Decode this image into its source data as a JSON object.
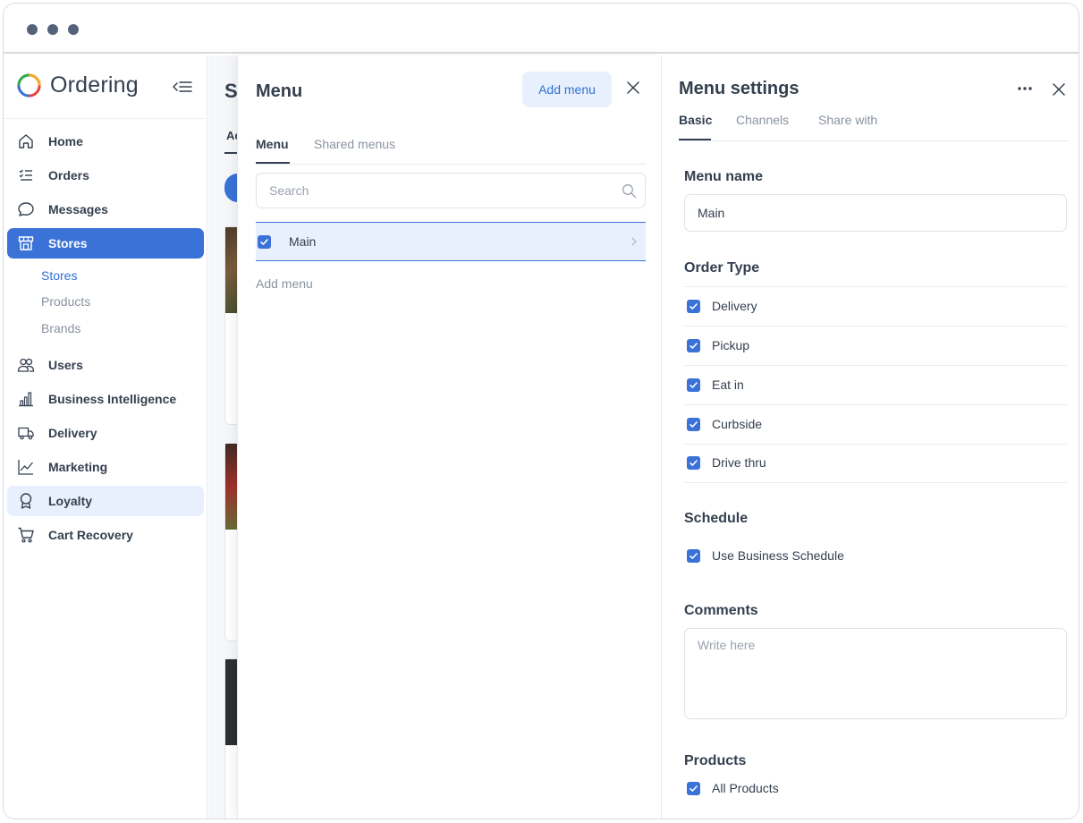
{
  "window": {
    "controls": [
      "close",
      "minimize",
      "zoom"
    ]
  },
  "sidebar": {
    "brand": "Ordering",
    "items": [
      {
        "label": "Home",
        "icon": "home-icon"
      },
      {
        "label": "Orders",
        "icon": "list-icon"
      },
      {
        "label": "Messages",
        "icon": "chat-icon"
      },
      {
        "label": "Stores",
        "icon": "store-icon",
        "active": true
      },
      {
        "label": "Users",
        "icon": "users-icon"
      },
      {
        "label": "Business Intelligence",
        "icon": "bar-chart-icon"
      },
      {
        "label": "Delivery",
        "icon": "truck-icon"
      },
      {
        "label": "Marketing",
        "icon": "trend-chart-icon"
      },
      {
        "label": "Loyalty",
        "icon": "award-icon"
      },
      {
        "label": "Cart Recovery",
        "icon": "cart-icon"
      }
    ],
    "sub_items": [
      {
        "label": "Stores",
        "active": true
      },
      {
        "label": "Products"
      },
      {
        "label": "Brands"
      }
    ]
  },
  "background": {
    "title_fragment": "S",
    "tab_fragment": "Ac"
  },
  "menu_panel": {
    "title": "Menu",
    "add_button": "Add menu",
    "tabs": [
      {
        "label": "Menu",
        "active": true
      },
      {
        "label": "Shared menus"
      }
    ],
    "search": {
      "placeholder": "Search",
      "value": ""
    },
    "menus": [
      {
        "label": "Main",
        "checked": true,
        "selected": true
      }
    ],
    "add_link": "Add menu"
  },
  "settings_panel": {
    "title": "Menu settings",
    "tabs": [
      {
        "label": "Basic",
        "active": true
      },
      {
        "label": "Channels"
      },
      {
        "label": "Share with"
      }
    ],
    "menu_name": {
      "label": "Menu name",
      "value": "Main"
    },
    "order_type": {
      "label": "Order Type",
      "options": [
        {
          "label": "Delivery",
          "checked": true
        },
        {
          "label": "Pickup",
          "checked": true
        },
        {
          "label": "Eat in",
          "checked": true
        },
        {
          "label": "Curbside",
          "checked": true
        },
        {
          "label": "Drive thru",
          "checked": true
        }
      ]
    },
    "schedule": {
      "label": "Schedule",
      "option": "Use Business Schedule",
      "checked": true
    },
    "comments": {
      "label": "Comments",
      "placeholder": "Write here",
      "value": ""
    },
    "products": {
      "label": "Products",
      "option": "All Products",
      "checked": true
    }
  },
  "colors": {
    "accent": "#3a72d8",
    "accent_soft": "#e9f0fd",
    "text": "#344050",
    "muted": "#8a93a0",
    "border": "#dfe3e8"
  }
}
